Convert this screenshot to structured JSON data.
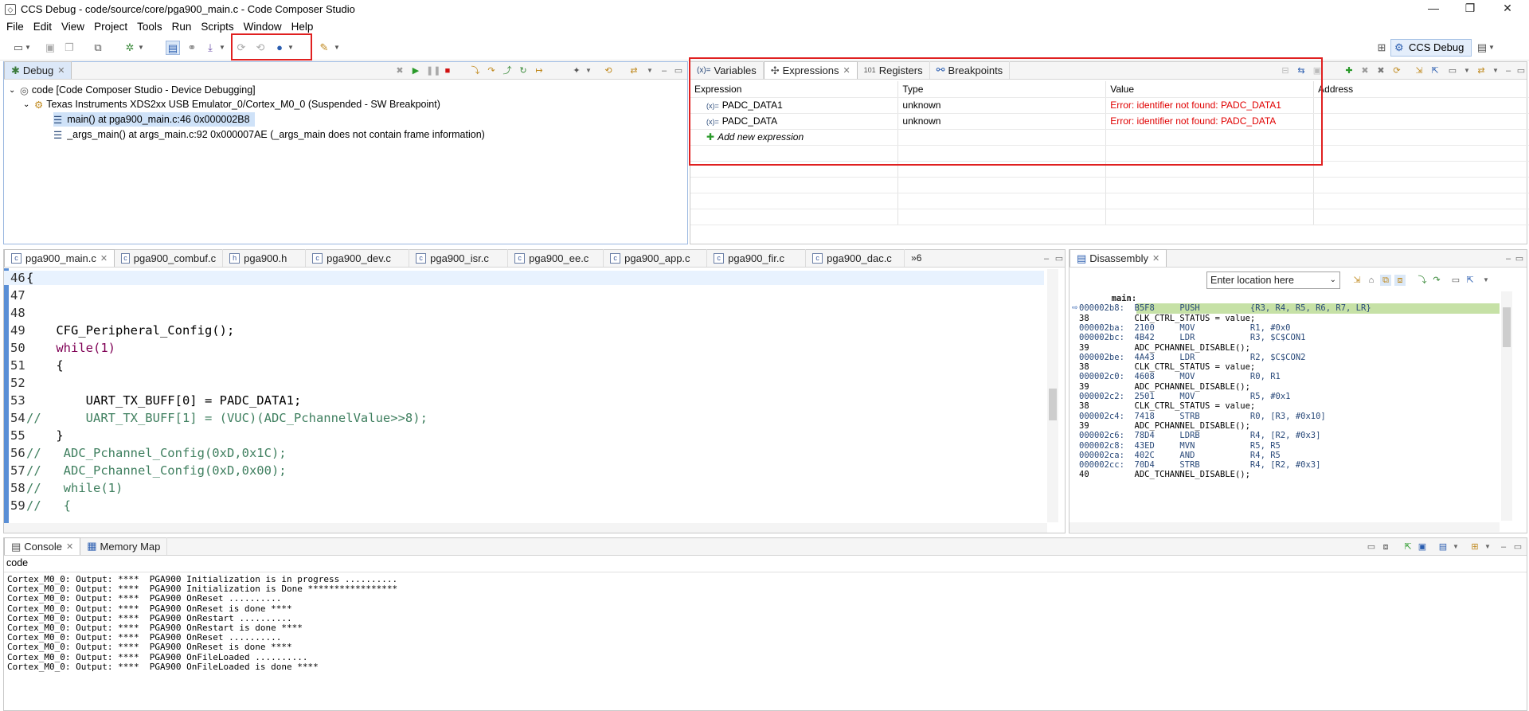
{
  "window": {
    "title": "CCS Debug - code/source/core/pga900_main.c - Code Composer Studio",
    "minimize": "—",
    "maximize": "❐",
    "close": "✕"
  },
  "menu": [
    "File",
    "Edit",
    "View",
    "Project",
    "Tools",
    "Run",
    "Scripts",
    "Window",
    "Help"
  ],
  "perspective": {
    "label": "CCS Debug"
  },
  "debug_view": {
    "tab": "Debug",
    "rows": [
      "code [Code Composer Studio - Device Debugging]",
      "Texas Instruments XDS2xx USB Emulator_0/Cortex_M0_0 (Suspended - SW Breakpoint)",
      "main() at pga900_main.c:46 0x000002B8",
      "_args_main() at args_main.c:92 0x000007AE  (_args_main does not contain frame information)"
    ]
  },
  "expressions_view": {
    "tabs": [
      "Variables",
      "Expressions",
      "Registers",
      "Breakpoints"
    ],
    "columns": [
      "Expression",
      "Type",
      "Value",
      "Address"
    ],
    "rows": [
      {
        "expression": "PADC_DATA1",
        "type": "unknown",
        "value": "Error: identifier not found: PADC_DATA1"
      },
      {
        "expression": "PADC_DATA",
        "type": "unknown",
        "value": "Error: identifier not found: PADC_DATA"
      }
    ],
    "add_new": "Add new expression"
  },
  "editor": {
    "tabs": [
      "pga900_main.c",
      "pga900_combuf.c",
      "pga900.h",
      "pga900_dev.c",
      "pga900_isr.c",
      "pga900_ee.c",
      "pga900_app.c",
      "pga900_fir.c",
      "pga900_dac.c"
    ],
    "overflow": "»6",
    "lines": [
      {
        "n": "46",
        "code": "{"
      },
      {
        "n": "47",
        "code": ""
      },
      {
        "n": "48",
        "code": ""
      },
      {
        "n": "49",
        "code": "    CFG_Peripheral_Config();"
      },
      {
        "n": "50",
        "code": "    while(1)"
      },
      {
        "n": "51",
        "code": "    {"
      },
      {
        "n": "52",
        "code": ""
      },
      {
        "n": "53",
        "code": "        UART_TX_BUFF[0] = PADC_DATA1;"
      },
      {
        "n": "54",
        "code": "//      UART_TX_BUFF[1] = (VUC)(ADC_PchannelValue>>8);"
      },
      {
        "n": "55",
        "code": "    }"
      },
      {
        "n": "56",
        "code": "//   ADC_Pchannel_Config(0xD,0x1C);"
      },
      {
        "n": "57",
        "code": "//   ADC_Pchannel_Config(0xD,0x00);"
      },
      {
        "n": "58",
        "code": "//   while(1)"
      },
      {
        "n": "59",
        "code": "//   {"
      }
    ]
  },
  "disassembly": {
    "tab": "Disassembly",
    "location_placeholder": "Enter location here",
    "rows": [
      "        main:",
      "000002b8:  B5F8     PUSH          {R3, R4, R5, R6, R7, LR}",
      "38         CLK_CTRL_STATUS = value;",
      "000002ba:  2100     MOV           R1, #0x0",
      "000002bc:  4B42     LDR           R3, $C$CON1",
      "39         ADC_PCHANNEL_DISABLE();",
      "000002be:  4A43     LDR           R2, $C$CON2",
      "38         CLK_CTRL_STATUS = value;",
      "000002c0:  4608     MOV           R0, R1",
      "39         ADC_PCHANNEL_DISABLE();",
      "000002c2:  2501     MOV           R5, #0x1",
      "38         CLK_CTRL_STATUS = value;",
      "000002c4:  7418     STRB          R0, [R3, #0x10]",
      "39         ADC_PCHANNEL_DISABLE();",
      "000002c6:  78D4     LDRB          R4, [R2, #0x3]",
      "000002c8:  43ED     MVN           R5, R5",
      "000002ca:  402C     AND           R4, R5",
      "000002cc:  70D4     STRB          R4, [R2, #0x3]",
      "40         ADC_TCHANNEL_DISABLE();"
    ]
  },
  "console": {
    "tabs": [
      "Console",
      "Memory Map"
    ],
    "name": "code",
    "lines": [
      "Cortex_M0_0: Output: ****  PGA900 Initialization is in progress ..........",
      "Cortex_M0_0: Output: ****  PGA900 Initialization is Done *****************",
      "Cortex_M0_0: Output: ****  PGA900 OnReset ..........",
      "Cortex_M0_0: Output: ****  PGA900 OnReset is done ****",
      "Cortex_M0_0: Output: ****  PGA900 OnRestart ..........",
      "Cortex_M0_0: Output: ****  PGA900 OnRestart is done ****",
      "Cortex_M0_0: Output: ****  PGA900 OnReset ..........",
      "Cortex_M0_0: Output: ****  PGA900 OnReset is done ****",
      "Cortex_M0_0: Output: ****  PGA900 OnFileLoaded ..........",
      "Cortex_M0_0: Output: ****  PGA900 OnFileLoaded is done ****"
    ]
  },
  "colors": {
    "highlight_box": "#e02020",
    "error": "#e00000",
    "keyword": "#7f0055",
    "comment": "#3f7f5f",
    "current_line": "#e8f2fe",
    "asm_current": "#c6e1a6"
  }
}
